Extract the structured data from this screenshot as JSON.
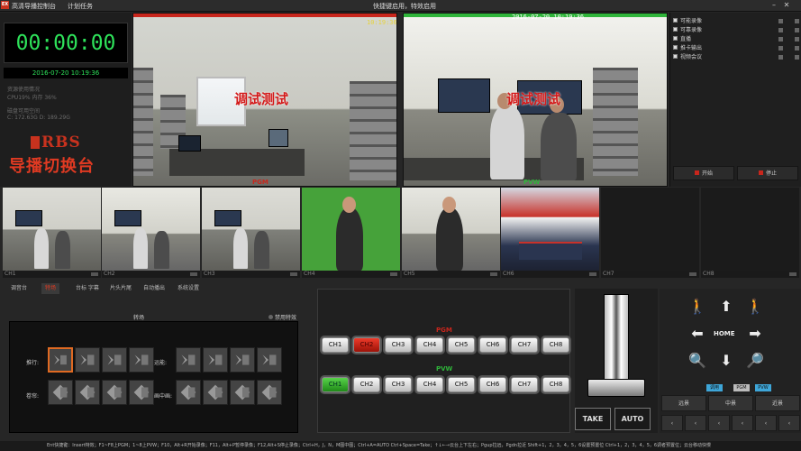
{
  "app": {
    "title": "高清导播控制台",
    "menu_schedule": "计划任务",
    "banner": "快捷键启用，特效启用"
  },
  "left": {
    "timer": "00:00:00",
    "datetime": "2016-07-20 10:19:36",
    "stats": [
      "资源使用情况",
      "CPU19%  内存 36%",
      "磁盘可用空间",
      "C: 172.63G D: 189.29G"
    ],
    "brand_logo_text": "RBS",
    "brand_name": "导播切换台"
  },
  "pgm_monitor": {
    "timestamp": "10:19:36",
    "overlay": "调试测试",
    "label": "PGM"
  },
  "pvw_monitor": {
    "timestamp": "2016-07-20 10:19:36",
    "overlay": "调试测试",
    "label": "PVW"
  },
  "tasks": {
    "items": [
      "可能录像",
      "可靠录像",
      "直播",
      "推卡输出",
      "视频会议"
    ],
    "start_label": "开始",
    "stop_label": "停止"
  },
  "thumbnails": [
    {
      "label": "CH1",
      "scene": "office"
    },
    {
      "label": "CH2",
      "scene": "office2"
    },
    {
      "label": "CH3",
      "scene": "office"
    },
    {
      "label": "CH4",
      "scene": "green"
    },
    {
      "label": "CH5",
      "scene": "anchor"
    },
    {
      "label": "CH6",
      "scene": "studio"
    },
    {
      "label": "CH7",
      "scene": "empty"
    },
    {
      "label": "CH8",
      "scene": "empty"
    }
  ],
  "tabs": [
    "调音台",
    "特场",
    "台标 字幕",
    "片头片尾",
    "自动播出",
    "系统设置"
  ],
  "transitions": {
    "title": "转场",
    "disable_label": "禁用特效",
    "row_labels": [
      "推行:",
      "卷帘:",
      "运能:",
      "画中画:"
    ]
  },
  "switcher": {
    "pgm_label": "PGM",
    "pvw_label": "PVW",
    "channels": [
      "CH1",
      "CH2",
      "CH3",
      "CH4",
      "CH5",
      "CH6",
      "CH7",
      "CH8"
    ],
    "pgm_active": "CH2",
    "pvw_active": "CH1",
    "take_label": "TAKE",
    "auto_label": "AUTO"
  },
  "ptz": {
    "home_label": "HOME",
    "chips": [
      "调用",
      "PGM",
      "PVW"
    ],
    "presets": [
      "远景",
      "中景",
      "近景"
    ]
  },
  "hotkeys": "Ent快捷键：Insert特效；F1~F8上PGM；1~8上PVW；F10，Alt+R开始录像；F11，Alt+P暂停录像；F12,Alt+S停止录像；Ctrl+H，J，N，M图中图；Ctrl+A=AUTO Ctrl+Space=Take；↑↓←→云台上下左右；Pgup拉远，Pgdn拉近 Shift+1，2，3，4，5，6设置预置位 Ctrl+1，2，3，4，5，6调者预置位；云台移动快慢"
}
